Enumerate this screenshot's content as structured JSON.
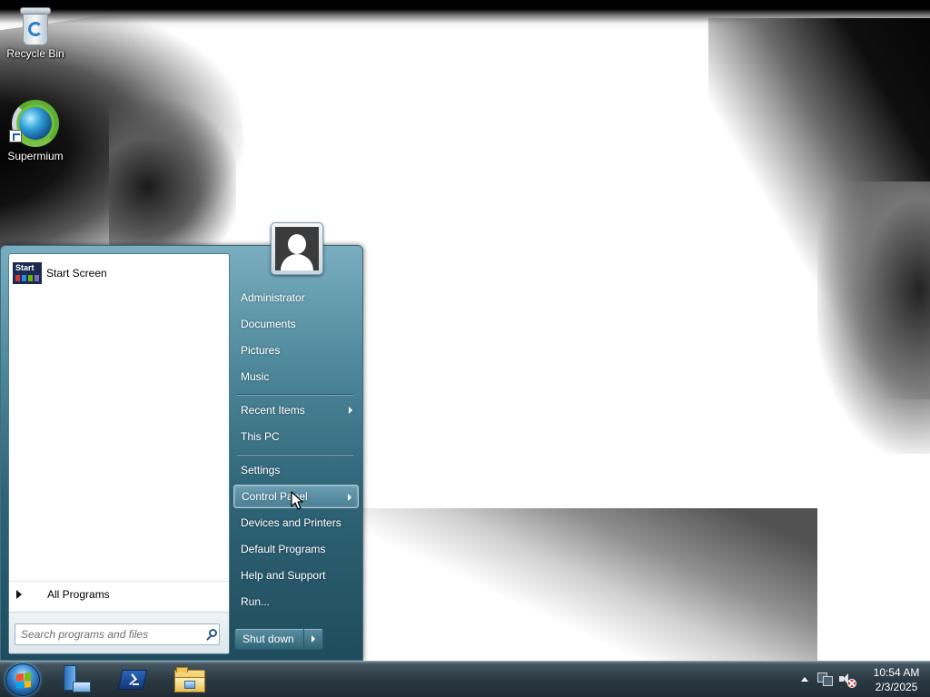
{
  "desktop": {
    "icons": [
      {
        "label": "Recycle Bin",
        "icon": "recycle-bin-icon"
      },
      {
        "label": "Supermium",
        "icon": "supermium-browser-icon"
      }
    ]
  },
  "start_menu": {
    "pinned": [
      {
        "label": "Start Screen",
        "icon": "start-screen-tile-icon",
        "tile_text": "Start"
      }
    ],
    "all_programs_label": "All Programs",
    "search": {
      "placeholder": "Search programs and files",
      "value": ""
    },
    "user_picture_icon": "user-avatar-icon",
    "right_items": [
      {
        "label": "Administrator"
      },
      {
        "label": "Documents"
      },
      {
        "label": "Pictures"
      },
      {
        "label": "Music"
      },
      {
        "label": "Recent Items",
        "has_submenu": true
      },
      {
        "label": "This PC"
      },
      {
        "label": "Settings"
      },
      {
        "label": "Control Panel",
        "has_submenu": true,
        "highlighted": true
      },
      {
        "label": "Devices and Printers"
      },
      {
        "label": "Default Programs"
      },
      {
        "label": "Help and Support"
      },
      {
        "label": "Run..."
      }
    ],
    "shutdown_label": "Shut down"
  },
  "taskbar": {
    "start_button_icon": "windows-orb-icon",
    "pinned": [
      {
        "name": "server-manager-icon"
      },
      {
        "name": "powershell-icon"
      },
      {
        "name": "file-explorer-icon"
      }
    ],
    "tray": {
      "icons": [
        "show-hidden-icons-icon",
        "network-icon",
        "volume-muted-icon"
      ],
      "time": "10:54 AM",
      "date": "2/3/2025"
    }
  },
  "colors": {
    "start_menu_accent": "#4d8799",
    "taskbar": "#2b3a43",
    "tile": "#1a2a52",
    "mute_badge": "#d12b2b"
  }
}
